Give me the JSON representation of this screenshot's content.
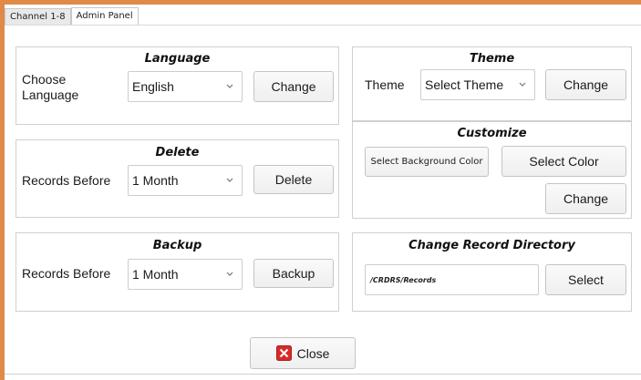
{
  "tabs": [
    {
      "label": "Channel 1-8",
      "active": false
    },
    {
      "label": "Admin Panel",
      "active": true
    }
  ],
  "language": {
    "title": "Language",
    "label": "Choose Language",
    "selected": "English",
    "button": "Change"
  },
  "delete": {
    "title": "Delete",
    "label": "Records Before",
    "selected": "1 Month",
    "button": "Delete"
  },
  "backup": {
    "title": "Backup",
    "label": "Records Before",
    "selected": "1 Month",
    "button": "Backup"
  },
  "theme": {
    "title": "Theme",
    "label": "Theme",
    "selected": "Select Theme",
    "button": "Change"
  },
  "customize": {
    "title": "Customize",
    "bg_button": "Select Background Color",
    "color_button": "Select Color",
    "change_button": "Change"
  },
  "record_directory": {
    "title": "Change Record Directory",
    "path": "/CRDRS/Records",
    "button": "Select"
  },
  "close_button": "Close",
  "colors": {
    "frame_accent": "#e08a4a",
    "close_icon": "#d62b2b"
  }
}
